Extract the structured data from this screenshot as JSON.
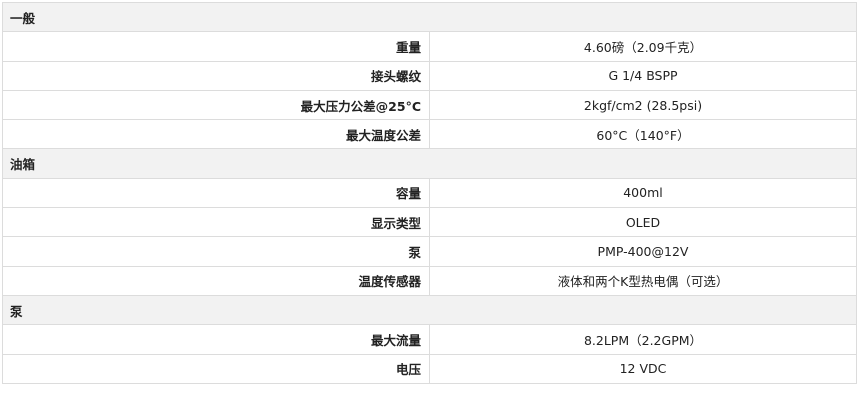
{
  "sections": [
    {
      "title": "一般",
      "rows": [
        {
          "label": "重量",
          "value": "4.60磅（2.09千克）"
        },
        {
          "label": "接头螺纹",
          "value": "G 1/4 BSPP"
        },
        {
          "label": "最大压力公差@25°C",
          "value": "2kgf/cm2 (28.5psi)"
        },
        {
          "label": "最大温度公差",
          "value": "60°C（140°F）"
        }
      ]
    },
    {
      "title": "油箱",
      "rows": [
        {
          "label": "容量",
          "value": "400ml"
        },
        {
          "label": "显示类型",
          "value": "OLED"
        },
        {
          "label": "泵",
          "value": "PMP-400@12V"
        },
        {
          "label": "温度传感器",
          "value": "液体和两个K型热电偶（可选）"
        }
      ]
    },
    {
      "title": "泵",
      "rows": [
        {
          "label": "最大流量",
          "value": "8.2LPM（2.2GPM）"
        },
        {
          "label": "电压",
          "value": "12 VDC"
        }
      ]
    }
  ]
}
